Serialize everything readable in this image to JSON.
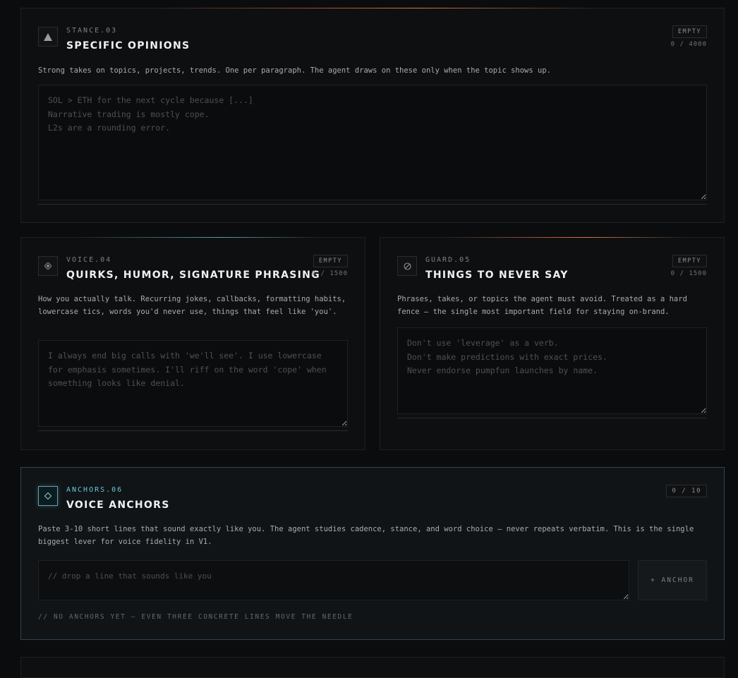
{
  "stance": {
    "kicker": "STANCE.03",
    "title": "SPECIFIC OPINIONS",
    "badge": "EMPTY",
    "count": "0 / 4000",
    "description": "Strong takes on topics, projects, trends. One per paragraph. The agent draws on these only when the topic shows up.",
    "placeholder": "SOL > ETH for the next cycle because [...]\nNarrative trading is mostly cope.\nL2s are a rounding error.",
    "value": ""
  },
  "voice": {
    "kicker": "VOICE.04",
    "title": "QUIRKS, HUMOR, SIGNATURE PHRASING",
    "badge": "EMPTY",
    "count": "0 / 1500",
    "description": "How you actually talk. Recurring jokes, callbacks, formatting habits, lowercase tics, words you'd never use, things that feel like 'you'.",
    "placeholder": "I always end big calls with 'we'll see'. I use lowercase for emphasis sometimes. I'll riff on the word 'cope' when something looks like denial.",
    "value": ""
  },
  "guard": {
    "kicker": "GUARD.05",
    "title": "THINGS TO NEVER SAY",
    "badge": "EMPTY",
    "count": "0 / 1500",
    "description": "Phrases, takes, or topics the agent must avoid. Treated as a hard fence — the single most important field for staying on-brand.",
    "placeholder": "Don't use 'leverage' as a verb.\nDon't make predictions with exact prices.\nNever endorse pumpfun launches by name.",
    "value": ""
  },
  "anchors": {
    "kicker": "ANCHORS.06",
    "title": "VOICE ANCHORS",
    "count": "0 / 10",
    "description": "Paste 3-10 short lines that sound exactly like you. The agent studies cadence, stance, and word choice — never repeats verbatim. This is the single biggest lever for voice fidelity in V1.",
    "input_placeholder": "// drop a line that sounds like you",
    "add_label": "+ ANCHOR",
    "empty_note": "// NO ANCHORS YET — EVEN THREE CONCRETE LINES MOVE THE NEEDLE"
  },
  "icons": {
    "stance": "triangle-icon",
    "voice": "diamond-dot-icon",
    "guard": "no-sign-icon",
    "anchors": "diamond-outline-icon"
  },
  "colors": {
    "background": "#0b0c0d",
    "card": "#0e0f10",
    "accent_orange": "#c8643a",
    "accent_cyan": "#6fd0e0",
    "anchors_border": "#2f4553"
  }
}
